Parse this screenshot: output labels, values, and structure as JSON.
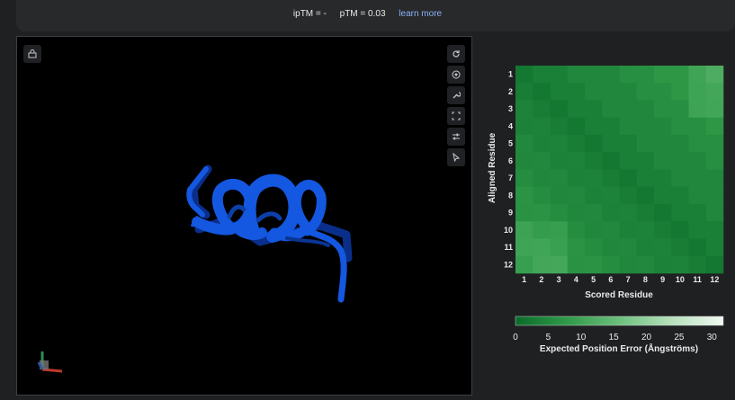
{
  "header": {
    "iptm_text": "ipTM = -",
    "ptm_text": "pTM = 0.03",
    "learn_more_label": "learn more"
  },
  "viewer": {
    "toolbar_icons": [
      "lock-icon",
      "rotate-icon",
      "center-icon",
      "wrench-icon",
      "fullscreen-icon",
      "sliders-icon",
      "pointer-icon"
    ],
    "ribbon_color": "#1457e0"
  },
  "pae": {
    "y_axis_label": "Aligned Residue",
    "x_axis_label": "Scored Residue",
    "residues": [
      "1",
      "2",
      "3",
      "4",
      "5",
      "6",
      "7",
      "8",
      "9",
      "10",
      "11",
      "12"
    ],
    "colorbar_title": "Expected Position Error (Ångströms)",
    "colorbar_ticks": [
      "0",
      "5",
      "10",
      "15",
      "20",
      "25",
      "30"
    ],
    "colorbar_range": [
      0,
      31.75
    ],
    "colorbar_colors": [
      "#0b6b2b",
      "#2f9a48",
      "#6cc07c",
      "#b6e0bc",
      "#f0f9f1"
    ]
  }
}
